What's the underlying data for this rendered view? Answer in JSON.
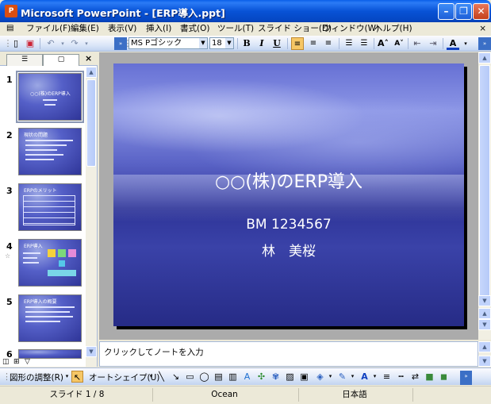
{
  "window": {
    "title": "Microsoft PowerPoint - [ERP導入.ppt]",
    "app_icon": "powerpoint-icon",
    "caption_buttons": [
      "minimize-icon",
      "restore-icon",
      "close-icon"
    ]
  },
  "menu": {
    "items": [
      "ファイル(F)",
      "編集(E)",
      "表示(V)",
      "挿入(I)",
      "書式(O)",
      "ツール(T)",
      "スライド ショー(D)",
      "ウィンドウ(W)",
      "ヘルプ(H)"
    ],
    "close_glyph": "×"
  },
  "toolbar": {
    "font_name": "MS Pゴシック",
    "font_size": "18",
    "bold": "B",
    "italic": "I",
    "underline": "U"
  },
  "left_pane": {
    "tab_outline": "outline-tab-icon",
    "tab_slides": "slides-tab-icon",
    "close_glyph": "×",
    "slide_numbers": [
      "1",
      "2",
      "3",
      "4",
      "5",
      "6"
    ],
    "thumb_titles": [
      "○○(株)のERP導入",
      "現状の問題",
      "ERPのメリット",
      "ERP導入",
      "ERP導入の概要",
      ""
    ]
  },
  "slide": {
    "title": "○○(株)のERP導入",
    "subtitle_line1": "BM 1234567",
    "subtitle_line2": "林　美桜"
  },
  "notes": {
    "placeholder": "クリックしてノートを入力"
  },
  "drawing_toolbar": {
    "draw_menu": "図形の調整(R)",
    "autoshapes_menu": "オートシェイプ(U)"
  },
  "status": {
    "slide_position": "スライド 1 / 8",
    "design_template": "Ocean",
    "language": "日本語"
  },
  "colors": {
    "title_bar": "#0853D6",
    "slide_background": "#3A42A8",
    "slide_text": "#FFFFFF"
  }
}
